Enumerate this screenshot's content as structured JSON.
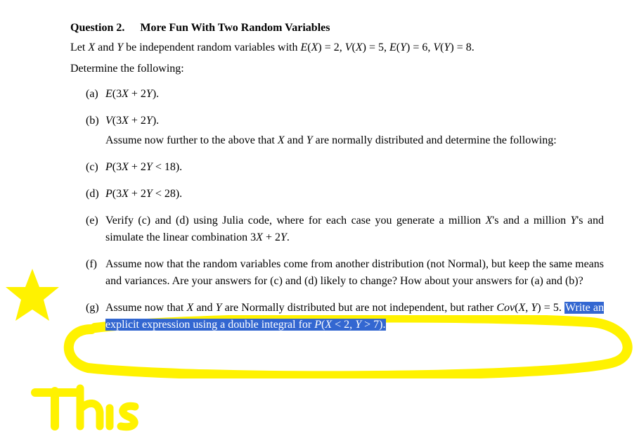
{
  "question": {
    "number_label": "Question  2.",
    "title": "More Fun With Two Random Variables",
    "intro_line1": "Let X and Y be independent random variables with E(X) = 2, V(X) = 5, E(Y) = 6, V(Y) = 8.",
    "intro_line2": "Determine the following:"
  },
  "items": {
    "a": {
      "label": "(a)",
      "text": "E(3X + 2Y)."
    },
    "b": {
      "label": "(b)",
      "text": "V(3X + 2Y).",
      "note": "Assume now further to the above that X and Y are normally distributed and determine the following:"
    },
    "c": {
      "label": "(c)",
      "text": "P(3X + 2Y < 18)."
    },
    "d": {
      "label": "(d)",
      "text": "P(3X + 2Y < 28)."
    },
    "e": {
      "label": "(e)",
      "text": "Verify (c) and (d) using Julia code, where for each case you generate a million X's and a million Y's and simulate the linear combination 3X + 2Y."
    },
    "f": {
      "label": "(f)",
      "text": "Assume now that the random variables come from another distribution (not Normal), but keep the same means and variances. Are your answers for (c) and (d) likely to change? How about your answers for (a) and (b)?"
    },
    "g": {
      "label": "(g)",
      "text_prefix": "Assume now that X and Y are Normally distributed but are not independent, but rather Cov(X, Y) = 5. ",
      "text_highlight": "Write an explicit expression using a double integral for P(X < 2, Y > 7).",
      "text_suffix": ""
    }
  },
  "annotation": {
    "handwritten": "This",
    "color": "#fff200"
  }
}
